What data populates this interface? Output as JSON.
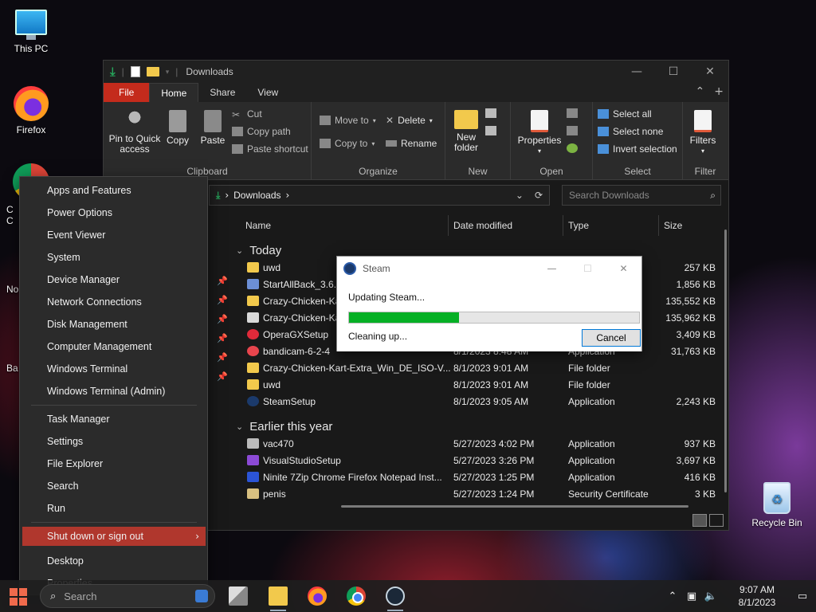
{
  "desktop": {
    "icons": [
      {
        "label": "This PC"
      },
      {
        "label": "Firefox"
      },
      {
        "label": "Recycle Bin"
      }
    ],
    "partial_labels": [
      "C",
      "C",
      "No",
      "Ba"
    ]
  },
  "explorer": {
    "title": "Downloads",
    "tabs": [
      "File",
      "Home",
      "Share",
      "View"
    ],
    "ribbon": {
      "clipboard": {
        "pin": "Pin to Quick access",
        "copy": "Copy",
        "paste": "Paste",
        "cut": "Cut",
        "copy_path": "Copy path",
        "paste_shortcut": "Paste shortcut",
        "label": "Clipboard"
      },
      "organize": {
        "move_to": "Move to",
        "copy_to": "Copy to",
        "delete": "Delete",
        "rename": "Rename",
        "label": "Organize"
      },
      "new": {
        "new_folder": "New folder",
        "label": "New"
      },
      "open": {
        "properties": "Properties",
        "label": "Open"
      },
      "select": {
        "select_all": "Select all",
        "select_none": "Select none",
        "invert": "Invert selection",
        "label": "Select"
      },
      "filter": {
        "filters": "Filters",
        "label": "Filter"
      }
    },
    "address": {
      "path": "Downloads"
    },
    "search": {
      "placeholder": "Search Downloads"
    },
    "columns": [
      "Name",
      "Date modified",
      "Type",
      "Size"
    ],
    "groups": [
      {
        "title": "Today",
        "rows": [
          {
            "name": "uwd",
            "date": "",
            "type": "",
            "size": "257 KB",
            "icon": "folder"
          },
          {
            "name": "StartAllBack_3.6.1(",
            "date": "",
            "type": "",
            "size": "1,856 KB",
            "icon": "app"
          },
          {
            "name": "Crazy-Chicken-Kar",
            "date": "",
            "type": "",
            "size": "135,552 KB",
            "icon": "folder"
          },
          {
            "name": "Crazy-Chicken-Kar",
            "date": "",
            "type": "",
            "size": "135,962 KB",
            "icon": "iso"
          },
          {
            "name": "OperaGXSetup",
            "date": "",
            "type": "",
            "size": "3,409 KB",
            "icon": "opera"
          },
          {
            "name": "bandicam-6-2-4",
            "date": "8/1/2023 8:48 AM",
            "type": "Application",
            "size": "31,763 KB",
            "icon": "bandi"
          },
          {
            "name": "Crazy-Chicken-Kart-Extra_Win_DE_ISO-V...",
            "date": "8/1/2023 9:01 AM",
            "type": "File folder",
            "size": "",
            "icon": "folder"
          },
          {
            "name": "uwd",
            "date": "8/1/2023 9:01 AM",
            "type": "File folder",
            "size": "",
            "icon": "folder"
          },
          {
            "name": "SteamSetup",
            "date": "8/1/2023 9:05 AM",
            "type": "Application",
            "size": "2,243 KB",
            "icon": "steam"
          }
        ]
      },
      {
        "title": "Earlier this year",
        "rows": [
          {
            "name": "vac470",
            "date": "5/27/2023 4:02 PM",
            "type": "Application",
            "size": "937 KB",
            "icon": "vac"
          },
          {
            "name": "VisualStudioSetup",
            "date": "5/27/2023 3:26 PM",
            "type": "Application",
            "size": "3,697 KB",
            "icon": "vs"
          },
          {
            "name": "Ninite 7Zip Chrome Firefox Notepad Inst...",
            "date": "5/27/2023 1:25 PM",
            "type": "Application",
            "size": "416 KB",
            "icon": "ninite"
          },
          {
            "name": "penis",
            "date": "5/27/2023 1:24 PM",
            "type": "Security Certificate",
            "size": "3 KB",
            "icon": "cert"
          }
        ]
      }
    ]
  },
  "steam_dialog": {
    "title": "Steam",
    "message": "Updating Steam...",
    "progress": 0.38,
    "status": "Cleaning up...",
    "cancel": "Cancel",
    "fill_color": "#06b025"
  },
  "context_menu": {
    "items": [
      "Apps and Features",
      "Power Options",
      "Event Viewer",
      "System",
      "Device Manager",
      "Network Connections",
      "Disk Management",
      "Computer Management",
      "Windows Terminal",
      "Windows Terminal (Admin)",
      "Task Manager",
      "Settings",
      "File Explorer",
      "Search",
      "Run",
      "Shut down or sign out",
      "Desktop",
      "Properties"
    ],
    "highlighted": "Shut down or sign out",
    "highlight_color": "#b0372d"
  },
  "taskbar": {
    "search_placeholder": "Search",
    "apps": [
      "task-view",
      "file-explorer",
      "firefox",
      "chrome",
      "steam"
    ],
    "time": "9:07 AM",
    "date": "8/1/2023"
  }
}
